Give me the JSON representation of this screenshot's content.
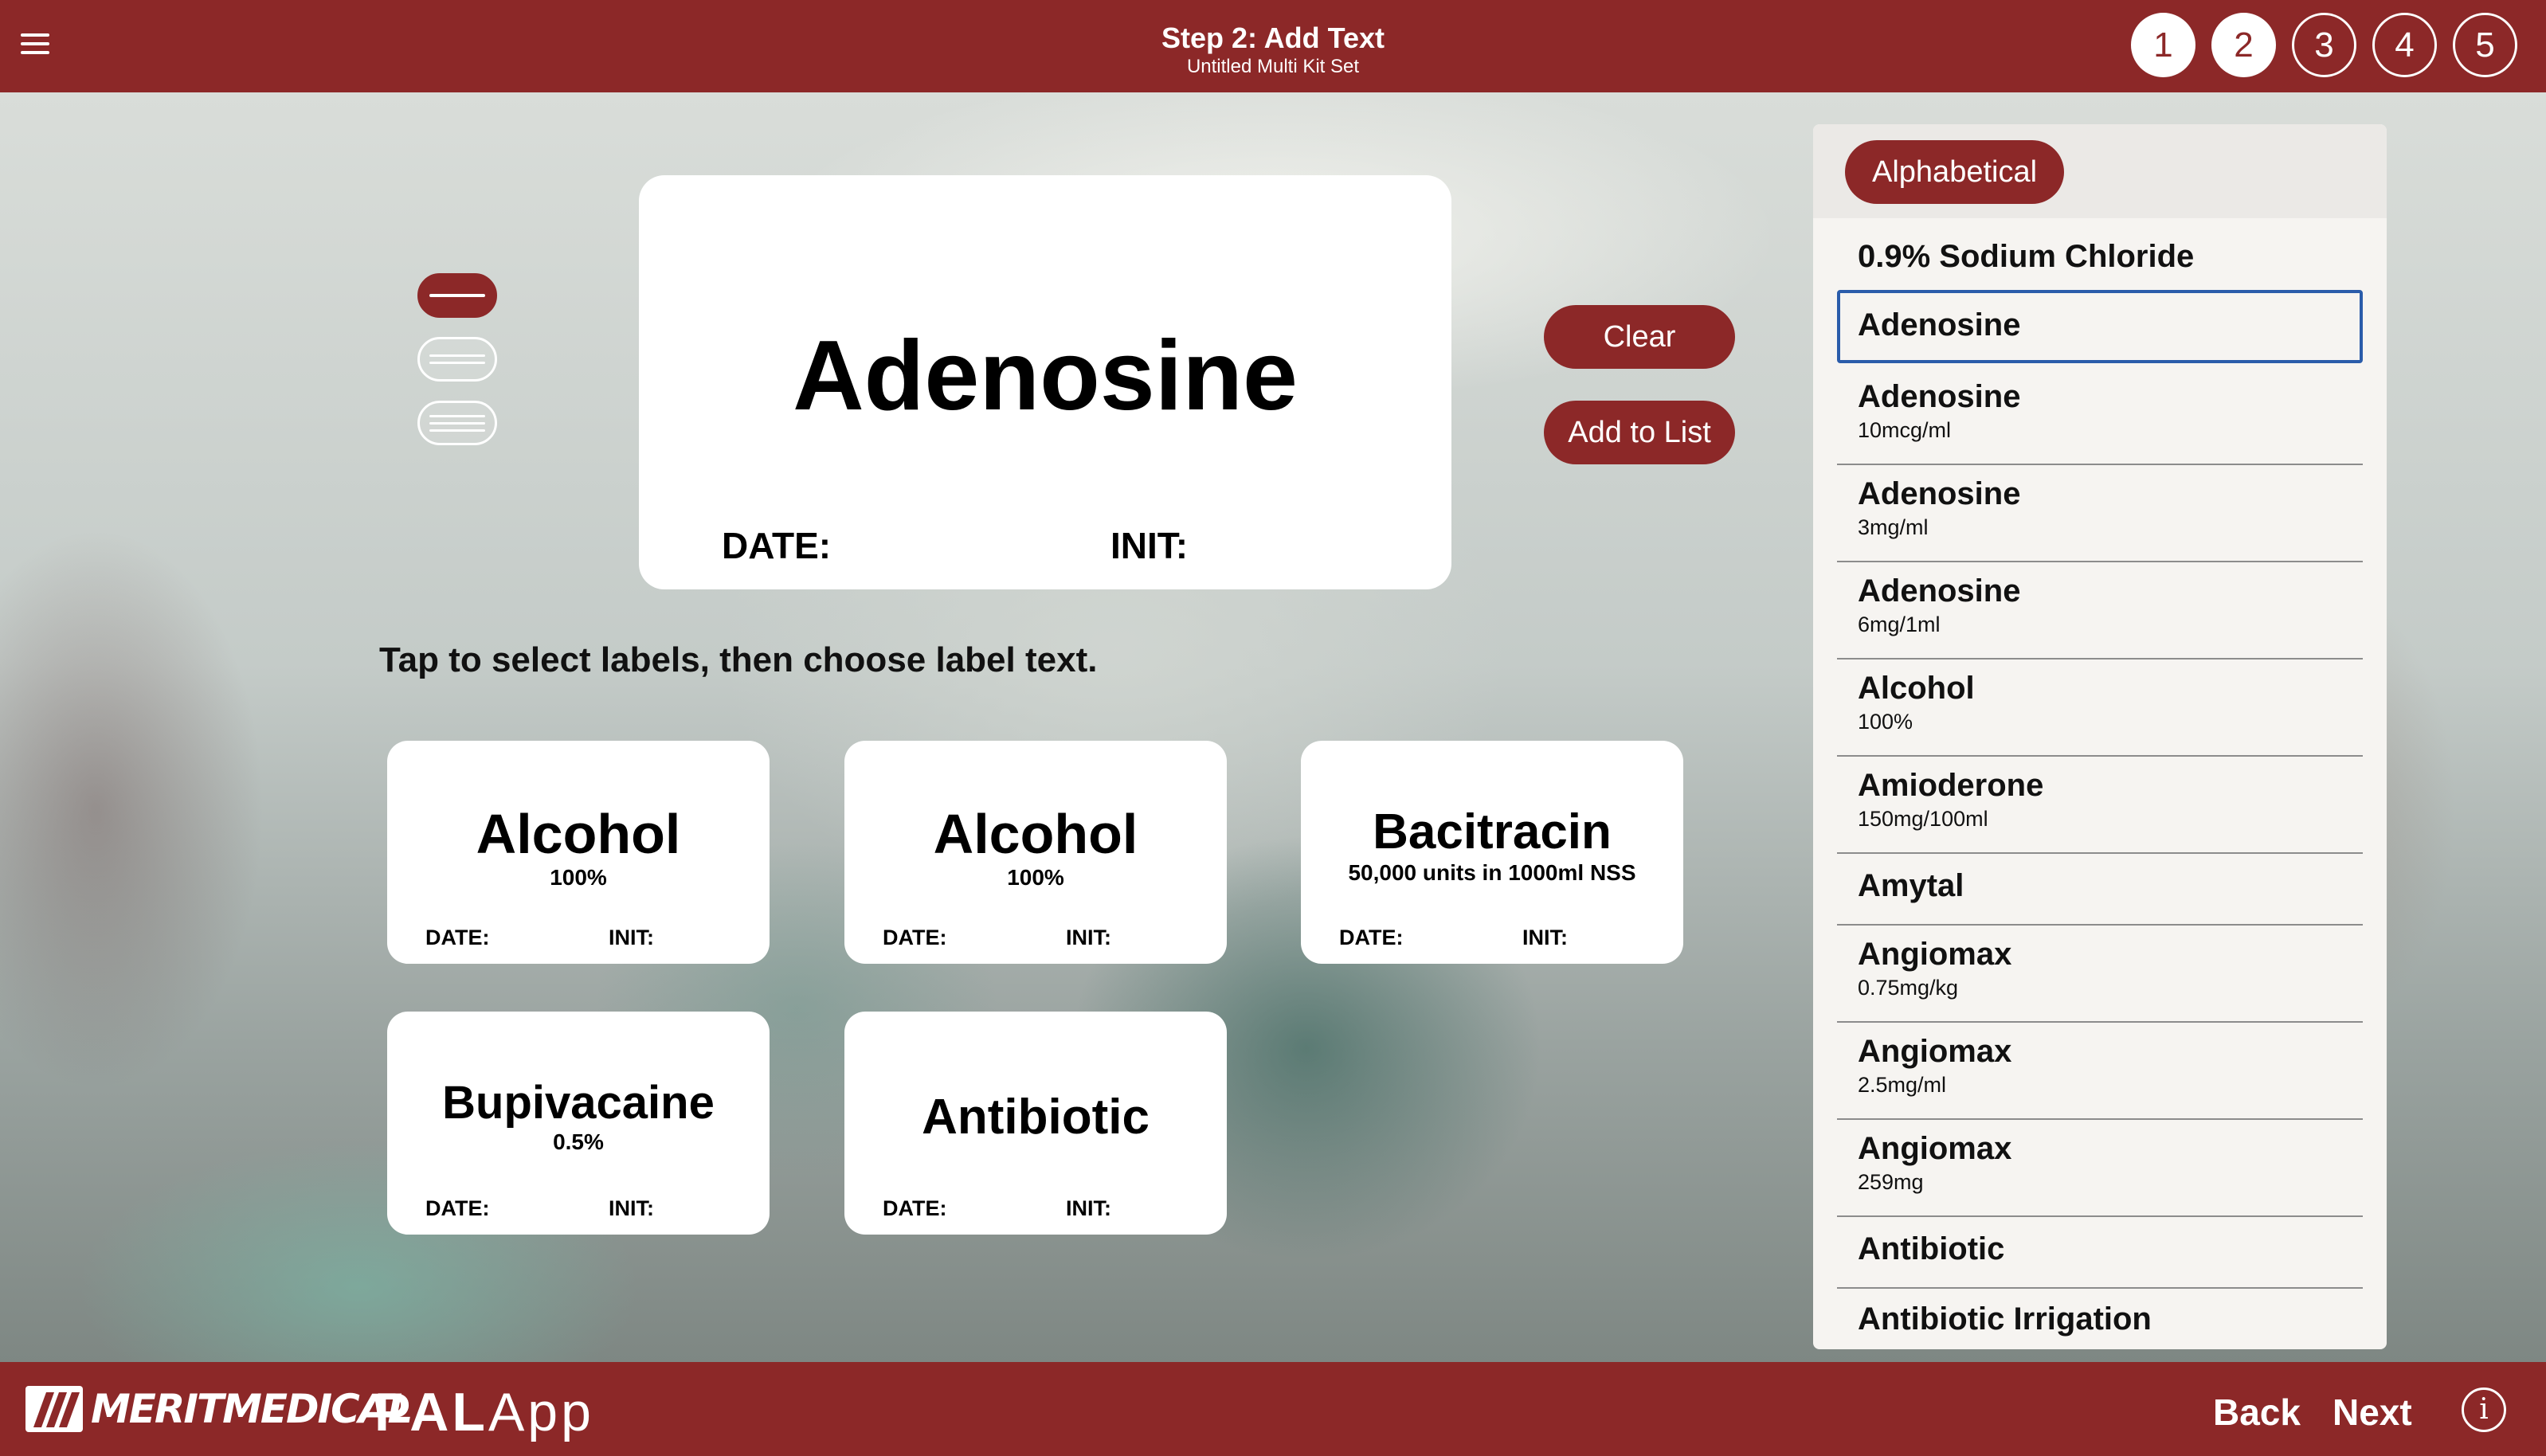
{
  "header": {
    "title": "Step 2: Add Text",
    "subtitle": "Untitled Multi Kit Set",
    "steps": [
      "1",
      "2",
      "3",
      "4",
      "5"
    ],
    "active_step": 2
  },
  "preview": {
    "name": "Adenosine",
    "date_label": "DATE:",
    "init_label": "INIT:"
  },
  "actions": {
    "clear": "Clear",
    "add_to_list": "Add to List"
  },
  "instructions": "Tap to select labels, then choose label text.",
  "tiles": [
    {
      "name": "Alcohol",
      "sub": "100%",
      "date": "DATE:",
      "init": "INIT:"
    },
    {
      "name": "Alcohol",
      "sub": "100%",
      "date": "DATE:",
      "init": "INIT:"
    },
    {
      "name": "Bacitracin",
      "sub": "50,000 units in 1000ml NSS",
      "date": "DATE:",
      "init": "INIT:"
    },
    {
      "name": "Bupivacaine",
      "sub": "0.5%",
      "date": "DATE:",
      "init": "INIT:"
    },
    {
      "name": "Antibiotic",
      "sub": "",
      "date": "DATE:",
      "init": "INIT:"
    }
  ],
  "list": {
    "sort_label": "Alphabetical",
    "items": [
      {
        "name": "0.9% Sodium Chloride",
        "sub": ""
      },
      {
        "name": "Adenosine",
        "sub": ""
      },
      {
        "name": "Adenosine",
        "sub": "10mcg/ml"
      },
      {
        "name": "Adenosine",
        "sub": "3mg/ml"
      },
      {
        "name": "Adenosine",
        "sub": "6mg/1ml"
      },
      {
        "name": "Alcohol",
        "sub": "100%"
      },
      {
        "name": "Amioderone",
        "sub": "150mg/100ml"
      },
      {
        "name": "Amytal",
        "sub": ""
      },
      {
        "name": "Angiomax",
        "sub": "0.75mg/kg"
      },
      {
        "name": "Angiomax",
        "sub": "2.5mg/ml"
      },
      {
        "name": "Angiomax",
        "sub": "259mg"
      },
      {
        "name": "Antibiotic",
        "sub": ""
      },
      {
        "name": "Antibiotic Irrigation",
        "sub": ""
      }
    ]
  },
  "footer": {
    "brand": "MERITMEDICAL",
    "app_name_bold": "PAL",
    "app_name_light": "App",
    "back": "Back",
    "next": "Next",
    "info": "i"
  },
  "colors": {
    "brand": "#8c2828",
    "selection_outline": "#2a5caa",
    "panel_bg": "#f6f4f1"
  }
}
